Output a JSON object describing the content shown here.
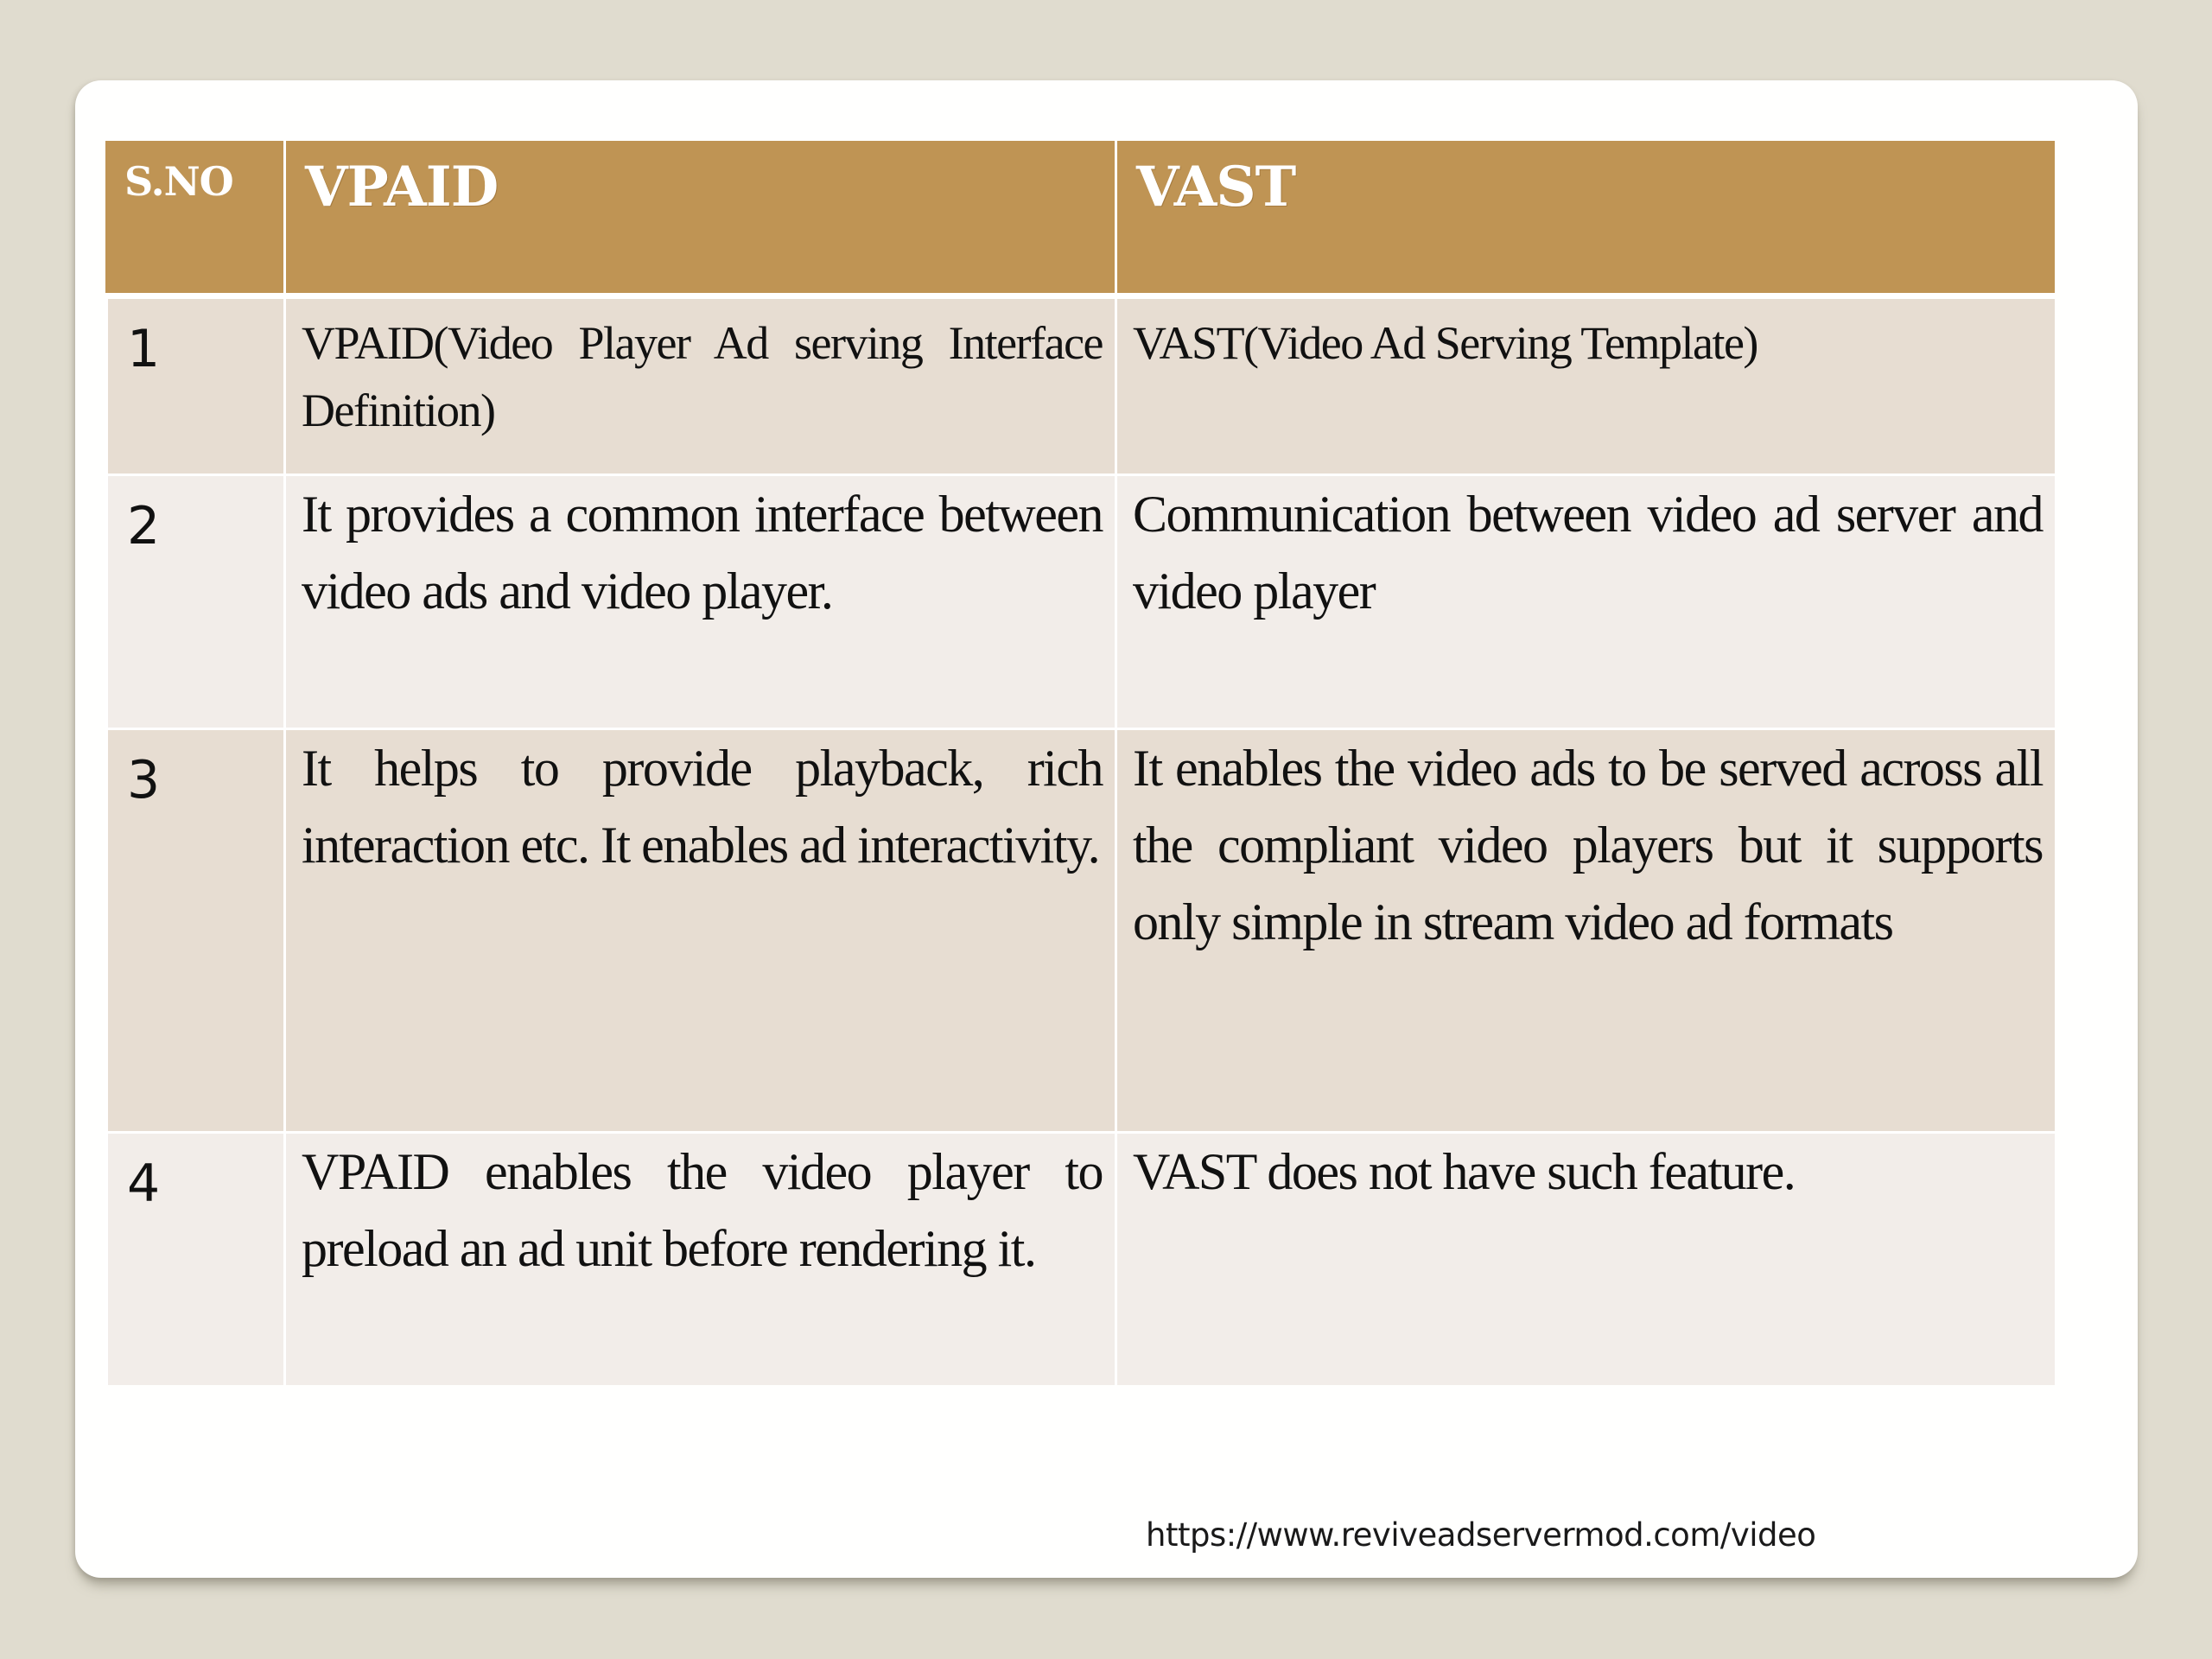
{
  "colors": {
    "background": "#E0DCCF",
    "card": "#FFFFFE",
    "header": "#BF9454",
    "row_odd": "#E7DDD2",
    "row_even": "#F2EDE9"
  },
  "table": {
    "headers": [
      "S.NO",
      "VPAID",
      "VAST"
    ],
    "rows": [
      {
        "sno": "1",
        "vpaid": "VPAID(Video Player Ad serving Interface Definition)",
        "vast": "VAST(Video Ad Serving Template)"
      },
      {
        "sno": "2",
        "vpaid": "It provides a common interface between video ads and video player.",
        "vast": "Communication between video ad server and video player"
      },
      {
        "sno": "3",
        "vpaid": "It helps to provide playback, rich interaction etc. It enables ad interactivity.",
        "vast": "It enables the video ads to be served across all the compliant video players but it supports only simple in stream video ad formats"
      },
      {
        "sno": "4",
        "vpaid": "VPAID enables the video player to preload an ad unit before rendering it.",
        "vast": "VAST does not have such feature."
      }
    ]
  },
  "footer": {
    "url": "https://www.reviveadservermod.com/video"
  }
}
